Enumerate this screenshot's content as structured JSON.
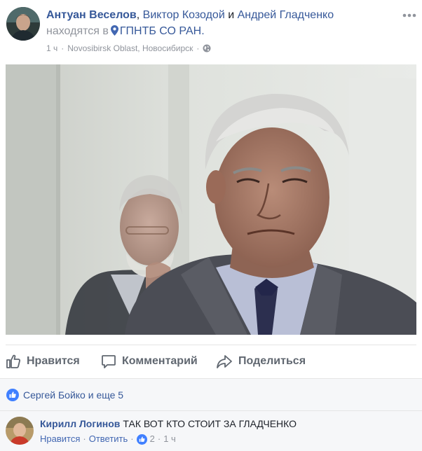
{
  "post": {
    "author": "Антуан Веселов",
    "with_sep": ",",
    "tagged_1": "Виктор Козодой",
    "and_word": "и",
    "tagged_2": "Андрей Гладченко",
    "location_prefix": "находятся в",
    "location": "ГПНТБ СО РАН.",
    "time": "1 ч",
    "meta_sep": "·",
    "place_detail": "Novosibirsk Oblast, Новосибирск",
    "meta_sep_2": "·",
    "privacy_icon": "globe-icon",
    "more_icon": "more-horizontal-icon"
  },
  "actions": {
    "like": "Нравится",
    "comment": "Комментарий",
    "share": "Поделиться"
  },
  "reactions": {
    "text": "Сергей Бойко и еще 5"
  },
  "comment": {
    "author": "Кирилл Логинов",
    "text": "ТАК ВОТ КТО СТОИТ ЗА ГЛАДЧЕНКО",
    "like_link": "Нравится",
    "sep1": "·",
    "reply_link": "Ответить",
    "sep2": "·",
    "likes_count": "2",
    "sep3": "·",
    "time": "1 ч"
  },
  "colors": {
    "link": "#365899",
    "meta": "#90949c",
    "like_blue": "#4080ff",
    "action_gray": "#606770"
  }
}
